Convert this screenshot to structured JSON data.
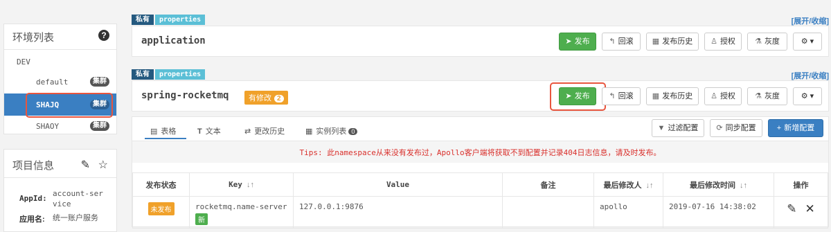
{
  "env_panel": {
    "title": "环境列表",
    "env": "DEV",
    "clusters": [
      {
        "name": "default",
        "tag": "集群"
      },
      {
        "name": "SHAJQ",
        "tag": "集群"
      },
      {
        "name": "SHAOY",
        "tag": "集群"
      }
    ]
  },
  "project_panel": {
    "title": "项目信息",
    "appid_label": "AppId:",
    "appid_value": "account-ser vice",
    "appname_label": "应用名:",
    "appname_value": "统一账户服务"
  },
  "namespaces": [
    {
      "tag_private": "私有",
      "tag_format": "properties",
      "expand": "[展开/收缩]",
      "name": "application"
    },
    {
      "tag_private": "私有",
      "tag_format": "properties",
      "expand": "[展开/收缩]",
      "name": "spring-rocketmq",
      "modified_label": "有修改",
      "modified_count": "2"
    }
  ],
  "buttons": {
    "publish": "发布",
    "rollback": "回滚",
    "history": "发布历史",
    "grant": "授权",
    "gray": "灰度"
  },
  "tabs": {
    "table": "表格",
    "text": "文本",
    "history": "更改历史",
    "instances": "实例列表",
    "instances_count": "0"
  },
  "actions": {
    "filter": "过滤配置",
    "sync": "同步配置",
    "add": "新增配置"
  },
  "tips": "Tips: 此namespace从来没有发布过，Apollo客户端将获取不到配置并记录404日志信息，请及时发布。",
  "table": {
    "headers": [
      "发布状态",
      "Key",
      "Value",
      "备注",
      "最后修改人",
      "最后修改时间",
      "操作"
    ],
    "rows": [
      {
        "status": "未发布",
        "key": "rocketmq.name-server",
        "new_badge": "新",
        "value": "127.0.0.1:9876",
        "comment": "",
        "modifier": "apollo",
        "time": "2019-07-16 14:38:02"
      }
    ]
  },
  "colors": {
    "publish_green": "#4eae4e",
    "active_blue": "#3a7fc2",
    "highlight_red": "#e8553e",
    "warning_orange": "#f0a12a"
  }
}
